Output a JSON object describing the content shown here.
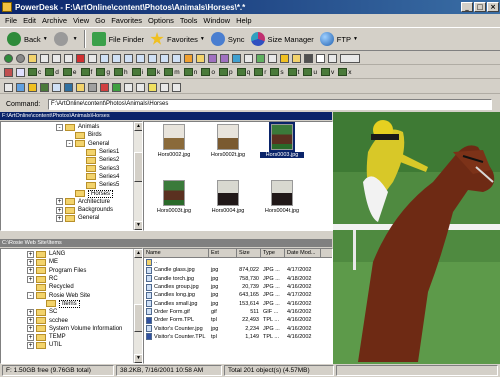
{
  "window": {
    "title": "PowerDesk - F:\\ArtOnline\\content\\Photos\\Animals\\Horses\\*.*",
    "controls": [
      "_",
      "□",
      "×"
    ]
  },
  "menu": [
    "File",
    "Edit",
    "Archive",
    "View",
    "Go",
    "Favorites",
    "Options",
    "Tools",
    "Window",
    "Help"
  ],
  "toolbar": {
    "back": "Back",
    "file_finder": "File Finder",
    "favorites": "Favorites",
    "sync": "Sync",
    "size_manager": "Size Manager",
    "ftp": "FTP"
  },
  "drivebar": [
    "c",
    "d",
    "e",
    "f",
    "g",
    "h",
    "i",
    "k",
    "m",
    "n",
    "o",
    "p",
    "q",
    "r",
    "s",
    "t",
    "u",
    "v",
    "x"
  ],
  "command": {
    "label": "Command:",
    "value": "F:\\ArtOnline\\content\\Photos\\Animals\\Horses"
  },
  "top_pane": {
    "header": "F:\\ArtOnline\\content\\Photos\\Animals\\Horses",
    "tree": [
      {
        "label": "Animals",
        "level": 0,
        "toggle": "-"
      },
      {
        "label": "Birds",
        "level": 1,
        "toggle": ""
      },
      {
        "label": "General",
        "level": 1,
        "toggle": "-"
      },
      {
        "label": "Series1",
        "level": 2,
        "toggle": ""
      },
      {
        "label": "Series2",
        "level": 2,
        "toggle": ""
      },
      {
        "label": "Series3",
        "level": 2,
        "toggle": ""
      },
      {
        "label": "Series4",
        "level": 2,
        "toggle": ""
      },
      {
        "label": "Series5",
        "level": 2,
        "toggle": ""
      },
      {
        "label": "Horses",
        "level": 1,
        "toggle": ""
      },
      {
        "label": "Architecture",
        "level": 0,
        "toggle": "+"
      },
      {
        "label": "Backgrounds",
        "level": 0,
        "toggle": "+"
      },
      {
        "label": "General",
        "level": 0,
        "toggle": "+"
      }
    ],
    "thumbnails": [
      {
        "label": "Hors0002.jpg",
        "selected": false
      },
      {
        "label": "Hors0002t.jpg",
        "selected": false
      },
      {
        "label": "Hors0003.jpg",
        "selected": true
      },
      {
        "label": "Hors0003t.jpg",
        "selected": false
      },
      {
        "label": "Hors0004.jpg",
        "selected": false
      },
      {
        "label": "Hors0004t.jpg",
        "selected": false
      }
    ]
  },
  "bottom_pane": {
    "header": "C:\\Rosie Web Site\\Items",
    "tree": [
      {
        "label": "LANG",
        "level": 0,
        "toggle": "+"
      },
      {
        "label": "ME",
        "level": 0,
        "toggle": "+"
      },
      {
        "label": "Program Files",
        "level": 0,
        "toggle": "+"
      },
      {
        "label": "RC",
        "level": 0,
        "toggle": "+"
      },
      {
        "label": "Recycled",
        "level": 0,
        "toggle": ""
      },
      {
        "label": "Rosie Web Site",
        "level": 0,
        "toggle": "-"
      },
      {
        "label": "Items",
        "level": 1,
        "toggle": ""
      },
      {
        "label": "SC",
        "level": 0,
        "toggle": "+"
      },
      {
        "label": "scchee",
        "level": 0,
        "toggle": "+"
      },
      {
        "label": "System Volume Information",
        "level": 0,
        "toggle": "+"
      },
      {
        "label": "TEMP",
        "level": 0,
        "toggle": "+"
      },
      {
        "label": "UTIL",
        "level": 0,
        "toggle": "+"
      }
    ],
    "columns": [
      "Name",
      "Ext",
      "Size",
      "Type",
      "Date Mod..."
    ],
    "rows": [
      {
        "name": "..",
        "ext": "",
        "size": "",
        "type": "",
        "date": ""
      },
      {
        "name": "Candle glass.jpg",
        "ext": "jpg",
        "size": "874,022",
        "type": "JPG ...",
        "date": "4/17/2002"
      },
      {
        "name": "Candle torch.jpg",
        "ext": "jpg",
        "size": "758,730",
        "type": "JPG ...",
        "date": "4/18/2002"
      },
      {
        "name": "Candles group.jpg",
        "ext": "jpg",
        "size": "20,739",
        "type": "JPG ...",
        "date": "4/16/2002"
      },
      {
        "name": "Candles long.jpg",
        "ext": "jpg",
        "size": "643,165",
        "type": "JPG ...",
        "date": "4/17/2002"
      },
      {
        "name": "Candles small.jpg",
        "ext": "jpg",
        "size": "153,614",
        "type": "JPG ...",
        "date": "4/16/2002"
      },
      {
        "name": "Order Form.gif",
        "ext": "gif",
        "size": "511",
        "type": "GIF ...",
        "date": "4/16/2002"
      },
      {
        "name": "Order Form.TPL",
        "ext": "tpl",
        "size": "22,493",
        "type": "TPL ...",
        "date": "4/16/2002"
      },
      {
        "name": "Visitor's Counter.jpg",
        "ext": "jpg",
        "size": "2,234",
        "type": "JPG ...",
        "date": "4/16/2002"
      },
      {
        "name": "Visitor's Counter.TPL",
        "ext": "tpl",
        "size": "1,149",
        "type": "TPL ...",
        "date": "4/16/2002"
      }
    ]
  },
  "status": {
    "free": "F: 1.50GB free (9.76GB total)",
    "file": "38.2KB, 7/16/2001 10:58 AM",
    "total": "Total 201 object(s) (4.57MB)"
  },
  "colors": {
    "titlebar": "#0a246a",
    "face": "#d4d0c8",
    "selection": "#0a246a",
    "folder": "#f3d36b"
  }
}
